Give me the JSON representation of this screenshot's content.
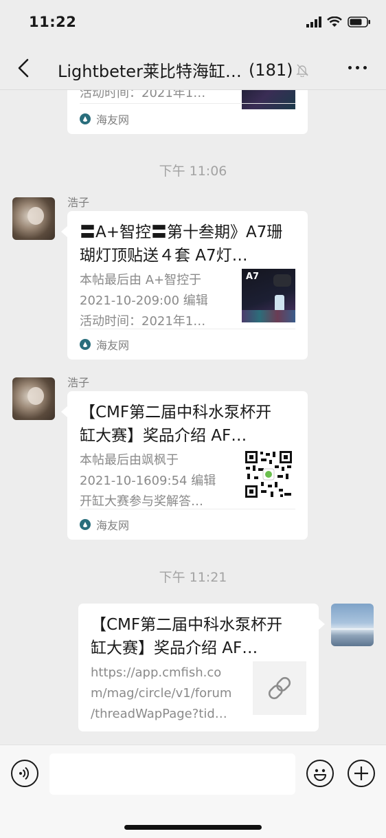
{
  "status": {
    "time": "11:22"
  },
  "nav": {
    "title": "Lightbeter莱比特海缸…",
    "count": "(181)",
    "icons": [
      "chevron-left-icon",
      "mute-bell-icon",
      "more-icon"
    ]
  },
  "chat": {
    "partial_card": {
      "desc_line": "活动时间：2021年1…",
      "source": "海友网"
    },
    "timestamps": [
      "下午 11:06",
      "下午 11:21"
    ],
    "messages": [
      {
        "sender": "浩子",
        "title": "〓A+智控〓第十叁期》A7珊 瑚灯顶贴送４套 A7灯…",
        "desc": [
          "本帖最后由 A+智控于",
          "2021-10-209:00 编辑",
          "活动时间：2021年1…"
        ],
        "thumb_label": "A7",
        "source": "海友网"
      },
      {
        "sender": "浩子",
        "title": "【CMF第二届中科水泵杯开缸大赛】奖品介绍 AF…",
        "desc": [
          "本帖最后由飒枫于",
          "2021-10-1609:54 编辑",
          "开缸大赛参与奖解答…"
        ],
        "thumb_label": "qr-code",
        "source": "海友网"
      },
      {
        "sender": "me",
        "title": "【CMF第二届中科水泵杯开缸大赛】奖品介绍 AF…",
        "desc": [
          "https://app.cmfish.co",
          "m/mag/circle/v1/forum",
          "/threadWapPage?tid…"
        ],
        "thumb_label": "link-icon"
      }
    ]
  },
  "input_bar": {
    "icons": [
      "voice-icon",
      "emoji-icon",
      "plus-icon"
    ],
    "placeholder": ""
  },
  "colors": {
    "background": "#ededed",
    "bubble": "#ffffff",
    "muted_text": "#8a8a8a"
  }
}
